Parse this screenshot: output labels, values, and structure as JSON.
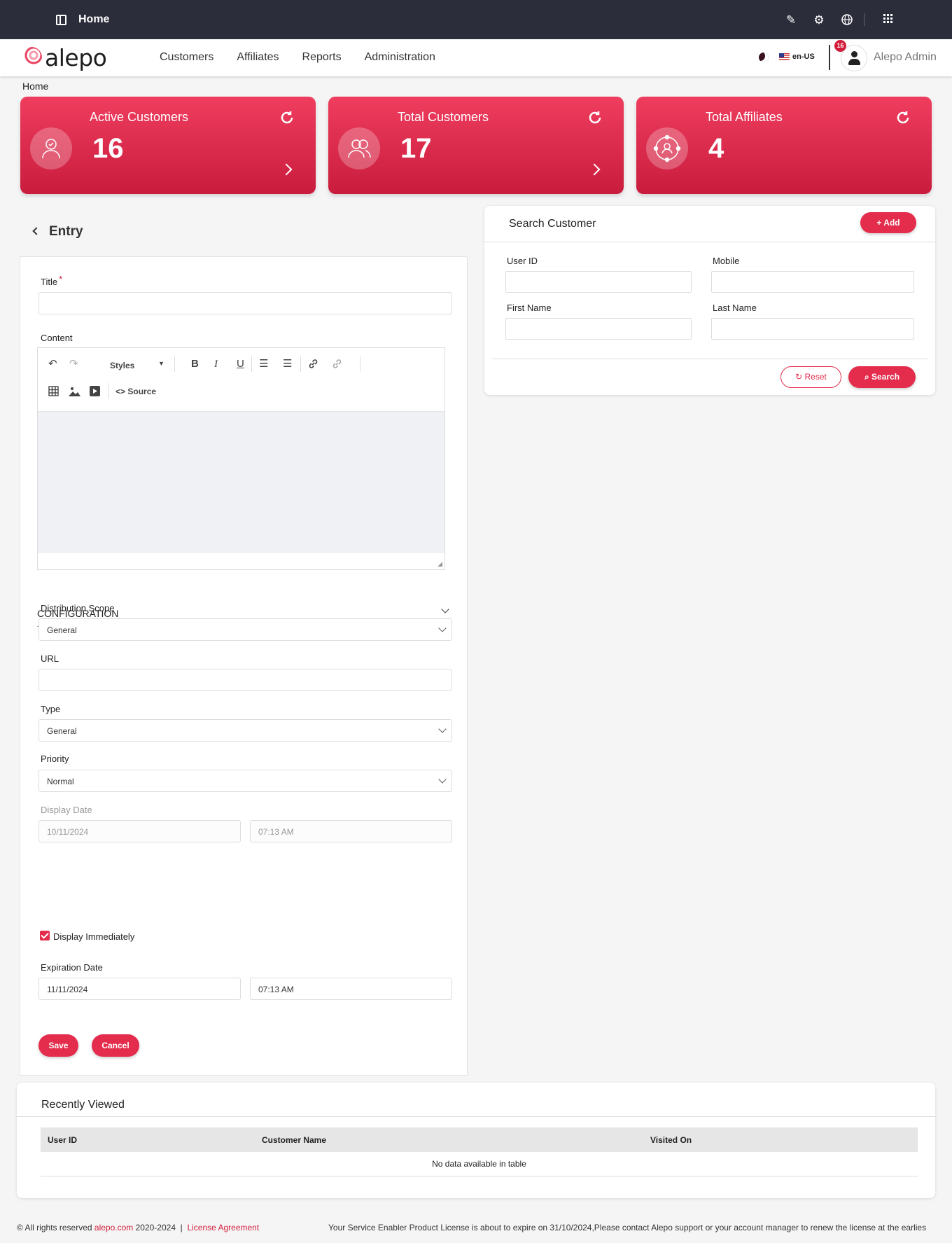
{
  "topbar": {
    "title": "Home"
  },
  "nav": {
    "logo": "alepo",
    "menu": [
      "Customers",
      "Affiliates",
      "Reports",
      "Administration"
    ],
    "language": "en-US",
    "notifications": "16",
    "user": "Alepo Admin"
  },
  "breadcrumb": "Home",
  "cards": [
    {
      "label": "Active Customers",
      "value": "16",
      "icon": "user-check-icon"
    },
    {
      "label": "Total Customers",
      "value": "17",
      "icon": "users-icon"
    },
    {
      "label": "Total Affiliates",
      "value": "4",
      "icon": "affiliates-network-icon"
    }
  ],
  "entry": {
    "heading": "Entry",
    "title_label": "Title",
    "required_mark": "*",
    "title_value": "",
    "content_label": "Content",
    "toolbar": {
      "styles": "Styles",
      "source": "Source"
    },
    "configuration": "CONFIGURATION",
    "distribution_label": "Distribution Scope",
    "distribution_value": "General",
    "url_label": "URL",
    "url_value": "",
    "type_label": "Type",
    "type_value": "General",
    "priority_label": "Priority",
    "priority_value": "Normal",
    "display_date_label": "Display Date",
    "display_date": "10/11/2024",
    "display_time": "07:13 AM",
    "display_immediately": "Display Immediately",
    "display_immediately_checked": true,
    "expiration_label": "Expiration Date",
    "expiration_date": "11/11/2024",
    "expiration_time": "07:13 AM",
    "save": "Save",
    "cancel": "Cancel"
  },
  "search": {
    "title": "Search Customer",
    "add": "Add",
    "user_id": "User ID",
    "mobile": "Mobile",
    "first_name": "First Name",
    "last_name": "Last Name",
    "reset": "Reset",
    "search": "Search"
  },
  "recent": {
    "title": "Recently Viewed",
    "columns": [
      "User ID",
      "Customer Name",
      "Visited On"
    ],
    "empty": "No data available in table"
  },
  "footer": {
    "copyright": "© All rights reserved ",
    "site": "alepo.com",
    "years": " 2020-2024  |  ",
    "license": "License Agreement",
    "notice": "Your Service Enabler Product License is about to expire on 31/10/2024,Please contact Alepo support or your account manager to renew the license at the earlies"
  },
  "colors": {
    "accent": "#e42c4c",
    "topbar": "#2b2d3b"
  }
}
